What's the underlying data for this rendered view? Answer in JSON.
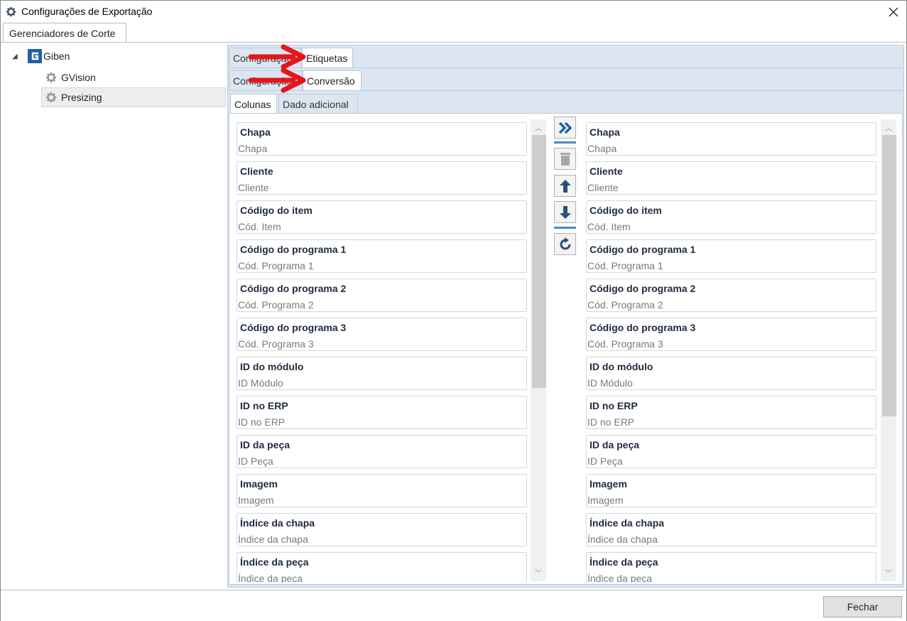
{
  "window": {
    "title": "Configurações de Exportação"
  },
  "top_tab": {
    "label": "Gerenciadores de Corte"
  },
  "tree": {
    "root": "Giben",
    "children": [
      "GVision",
      "Presizing"
    ],
    "selected": "Presizing"
  },
  "tabs_level1": [
    {
      "label": "Configuração"
    },
    {
      "label": "Etiquetas"
    }
  ],
  "tabs_level2": [
    {
      "label": "Configuração"
    },
    {
      "label": "Conversão"
    }
  ],
  "tabs_level3": [
    {
      "label": "Colunas"
    },
    {
      "label": "Dado adicional"
    }
  ],
  "left_list": [
    {
      "title": "Chapa",
      "sub": "Chapa"
    },
    {
      "title": "Cliente",
      "sub": "Cliente"
    },
    {
      "title": "Código do item",
      "sub": "Cód. Item"
    },
    {
      "title": "Código do programa 1",
      "sub": "Cód. Programa 1"
    },
    {
      "title": "Código do programa 2",
      "sub": "Cód. Programa 2"
    },
    {
      "title": "Código do programa 3",
      "sub": "Cód. Programa 3"
    },
    {
      "title": "ID do módulo",
      "sub": "ID Módulo"
    },
    {
      "title": "ID no ERP",
      "sub": "ID no ERP"
    },
    {
      "title": "ID da peça",
      "sub": "ID Peça"
    },
    {
      "title": "Imagem",
      "sub": "Imagem"
    },
    {
      "title": "Índice da chapa",
      "sub": "Índice da chapa"
    },
    {
      "title": "Índice da peça",
      "sub": "Índice da peça"
    }
  ],
  "right_list": [
    {
      "title": "Chapa",
      "sub": "Chapa"
    },
    {
      "title": "Cliente",
      "sub": "Cliente"
    },
    {
      "title": "Código do item",
      "sub": "Cód. Item"
    },
    {
      "title": "Código do programa 1",
      "sub": "Cód. Programa 1"
    },
    {
      "title": "Código do programa 2",
      "sub": "Cód. Programa 2"
    },
    {
      "title": "Código do programa 3",
      "sub": "Cód. Programa 3"
    },
    {
      "title": "ID do módulo",
      "sub": "ID Módulo"
    },
    {
      "title": "ID no ERP",
      "sub": "ID no ERP"
    },
    {
      "title": "ID da peça",
      "sub": "ID Peça"
    },
    {
      "title": "Imagem",
      "sub": "Imagem"
    },
    {
      "title": "Índice da chapa",
      "sub": "Índice da chapa"
    },
    {
      "title": "Índice da peça",
      "sub": "Índice da peça"
    }
  ],
  "footer": {
    "close_label": "Fechar"
  },
  "colors": {
    "accent": "#2f6fb1",
    "tab_bg": "#dce6f1",
    "annotation_arrow": "#e8141b"
  },
  "icons": [
    "gear-icon",
    "close-icon",
    "giben-logo-icon",
    "move-all-right-icon",
    "trash-icon",
    "arrow-up-icon",
    "arrow-down-icon",
    "refresh-icon"
  ]
}
